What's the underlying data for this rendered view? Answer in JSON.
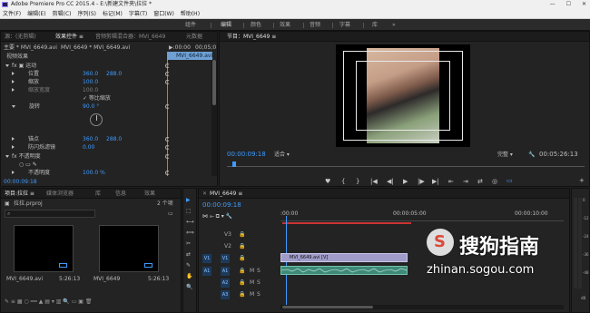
{
  "window": {
    "title": "Adobe Premiere Pro CC 2015.4 - E:\\新建文件夹\\拉拉 *",
    "controls": [
      "—",
      "☐",
      "✕"
    ]
  },
  "menu": [
    "文件(F)",
    "编辑(E)",
    "剪辑(C)",
    "序列(S)",
    "标记(M)",
    "字幕(T)",
    "窗口(W)",
    "帮助(H)"
  ],
  "workspaces": {
    "items": [
      "组件",
      "编辑",
      "颜色",
      "效果",
      "音频",
      "字幕",
      "库"
    ],
    "active": "编辑",
    "more": "»"
  },
  "effect_controls": {
    "tabs": [
      "源：(无剪辑)",
      "效果控件 ≡",
      "音频剪辑混合器：MVI_6649",
      "元数据"
    ],
    "master_label": "主要 * MVI_6649.avi",
    "seq_label": "MVI_6649 * MVI_6649.avi",
    "time_start": "▶:00:00",
    "time_end": "00;05;0",
    "clip_bar": "MVI_6649.avi",
    "section": "视频效果",
    "rows": [
      {
        "label": "fx ▣ 运动",
        "indent": 0
      },
      {
        "label": "位置",
        "v1": "360.0",
        "v2": "288.0",
        "indent": 2
      },
      {
        "label": "缩放",
        "v1": "100.0",
        "indent": 2
      },
      {
        "label": "缩放宽度",
        "v1": "100.0",
        "indent": 2,
        "dim": true
      },
      {
        "label": "",
        "check": "✓ 等比缩放",
        "indent": 4
      },
      {
        "label": "旋转",
        "v1": "90.0 °",
        "indent": 2
      },
      {
        "label": "",
        "v1": "",
        "indent": 2
      },
      {
        "label": "锚点",
        "v1": "360.0",
        "v2": "288.0",
        "indent": 2
      },
      {
        "label": "防闪烁滤镜",
        "v1": "0.00",
        "indent": 2
      },
      {
        "label": "fx 不透明度",
        "indent": 0
      },
      {
        "label": "",
        "indent": 2
      },
      {
        "label": "不透明度",
        "v1": "100.0 %",
        "indent": 2
      }
    ],
    "footer_time": "00:00:09:18"
  },
  "program": {
    "tab": "节目：MVI_6649 ≡",
    "timecode": "00:00:09:18",
    "fit": "适合",
    "quality": "完整",
    "duration": "00:05:26:13",
    "controls": [
      "♥",
      "{",
      "}",
      "|◀",
      "◀|",
      "▶",
      "|▶",
      "▶|",
      "⇤",
      "⇥",
      "⇄",
      "◎",
      "▭",
      "+"
    ]
  },
  "project": {
    "tabs": [
      "项目:拉拉 ≡",
      "媒体浏览器",
      "库",
      "信息",
      "效果"
    ],
    "search_placeholder": "",
    "file": "拉拉.prproj",
    "count": "2 个项",
    "items": [
      {
        "name": "MVI_6649.avi",
        "duration": "5:26:13"
      },
      {
        "name": "MVI_6649",
        "duration": "5:26:13"
      }
    ]
  },
  "tools": [
    "▶",
    "⬚",
    "⟷",
    "⟺",
    "✂",
    "⇄",
    "✎",
    "✋",
    "🔍"
  ],
  "timeline": {
    "tab": "MVI_6649 ≡",
    "timecode": "00:00:09:18",
    "ruler": [
      ":00:00",
      "00:00:05:00",
      "00:00:10:00"
    ],
    "playhead_fraction": 0.02,
    "tracks": [
      {
        "id": "V3",
        "type": "video"
      },
      {
        "id": "V2",
        "type": "video"
      },
      {
        "id": "V1",
        "type": "video",
        "clip": "MVI_6649.avi [V]"
      },
      {
        "id": "A1",
        "type": "audio"
      },
      {
        "id": "A2",
        "type": "audio"
      },
      {
        "id": "A3",
        "type": "audio"
      }
    ],
    "toggles": [
      "M",
      "S"
    ]
  },
  "meters": {
    "scale": [
      "0",
      "-12",
      "-24",
      "-36",
      "-48",
      "dB"
    ]
  },
  "watermark": {
    "brand": "搜狗指南",
    "url": "zhinan.sogou.com"
  },
  "colors": {
    "accent": "#3e9bff",
    "bg": "#232323",
    "clip_video": "#9f9cc9",
    "clip_audio": "#3f8a78"
  }
}
